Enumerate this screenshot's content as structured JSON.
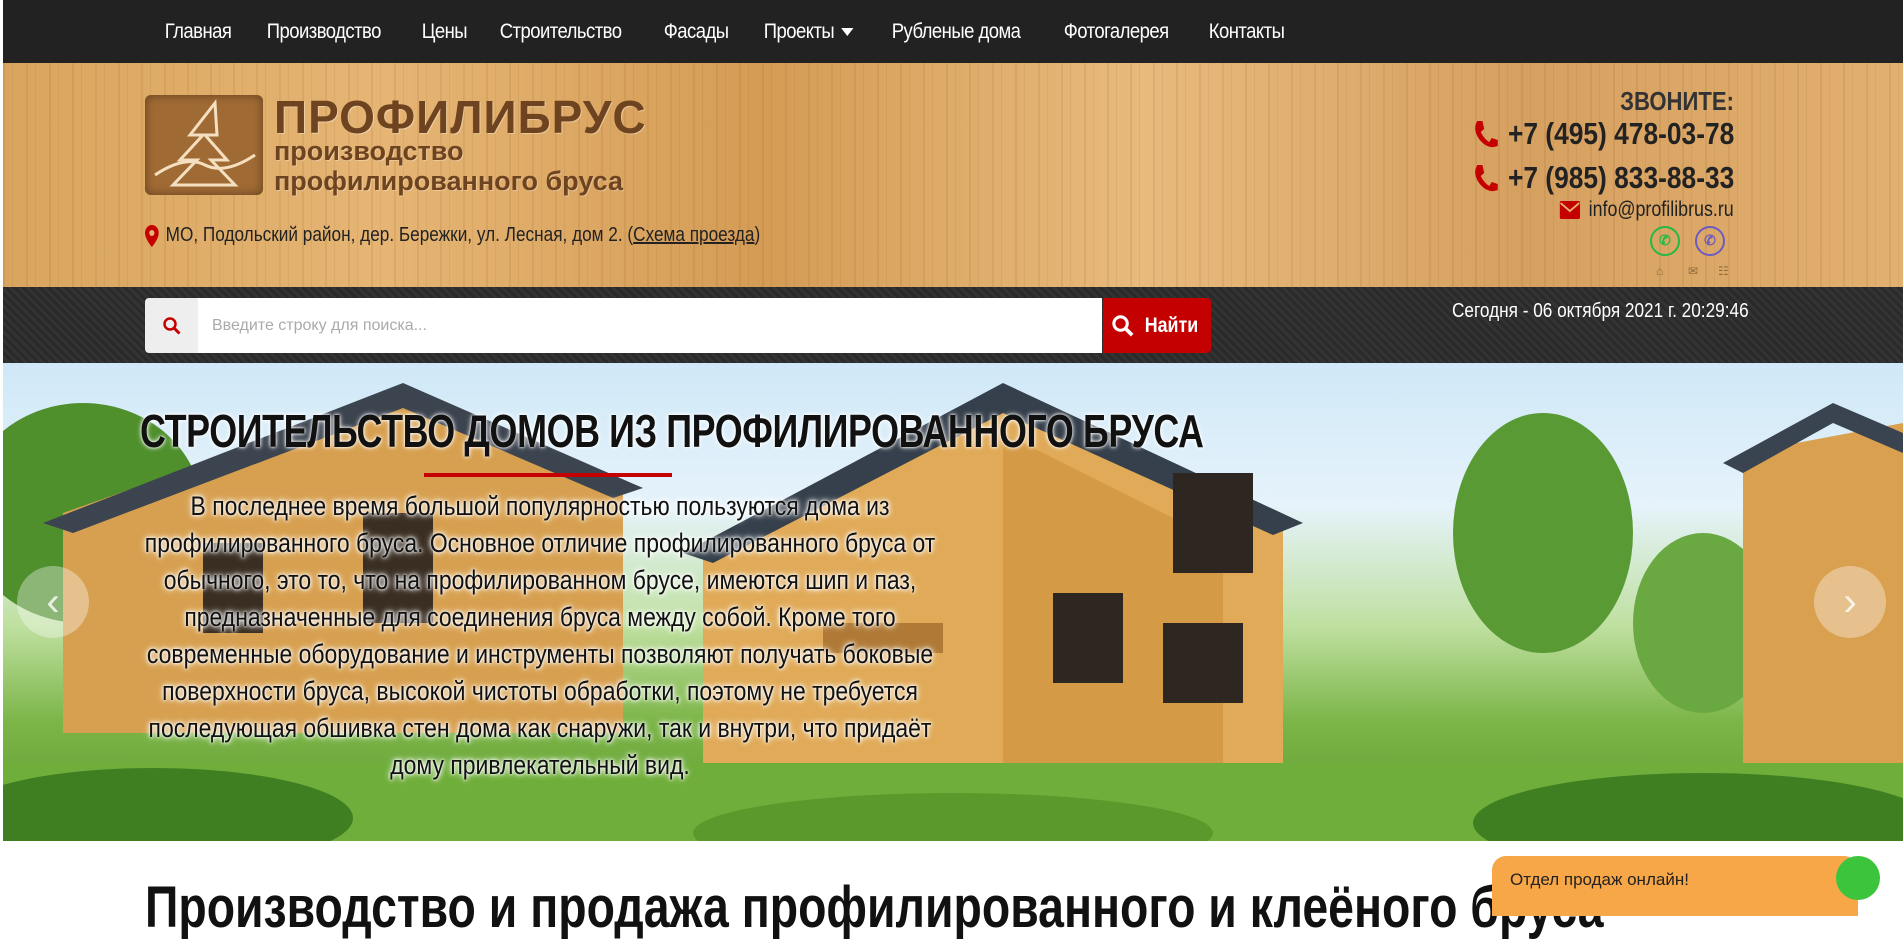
{
  "nav": {
    "items": [
      "Главная",
      "Производство",
      "Цены",
      "Строительство",
      "Фасады",
      "Проекты",
      "Рубленые дома",
      "Фотогалерея",
      "Контакты"
    ]
  },
  "header": {
    "brand": "ПРОФИЛИБРУС",
    "brand_sub1": "производство",
    "brand_sub2": "профилированного бруса",
    "address": "МО, Подольский район, дер. Бережки, ул. Лесная, дом 2.",
    "map_link": "Схема проезда",
    "call_label": "ЗВОНИТЕ:",
    "phone1": "+7 (495) 478-03-78",
    "phone2": "+7 (985) 833-88-33",
    "email": "info@profilibrus.ru"
  },
  "search": {
    "placeholder": "Введите строку для поиска...",
    "button": "Найти"
  },
  "datetime": "Сегодня - 06 октября 2021 г.   20:29:46",
  "hero": {
    "title": "СТРОИТЕЛЬСТВО ДОМОВ ИЗ ПРОФИЛИРОВАННОГО БРУСА",
    "text": "В последнее время большой популярностью пользуются дома из профилированного бруса. Основное отличие профилированного бруса от обычного, это то, что на профилированном брусе, имеются шип и паз, предназначенные для соединения бруса между собой. Кроме того современные оборудование и инструменты позволяют получать боковые поверхности бруса, высокой чистоты обработки, поэтому не требуется последующая обшивка стен дома как снаружи, так и внутри, что придаёт дому привлекательный вид."
  },
  "section_heading": "Производство и продажа профилированного и клеёного бруса",
  "chat": {
    "label": "Отдел продаж онлайн!"
  },
  "colors": {
    "accent": "#c50000",
    "nav_bg": "#222222",
    "chat": "#f7a747"
  }
}
